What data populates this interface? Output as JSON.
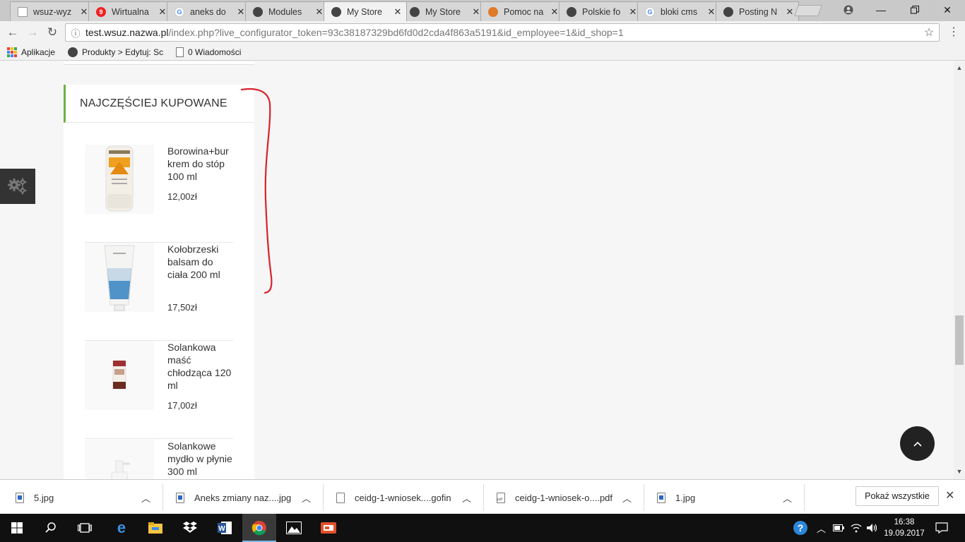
{
  "browser": {
    "tabs": [
      {
        "title": "wsuz-wyz",
        "favicon": "doc-icon",
        "active": false
      },
      {
        "title": "Wirtualna",
        "favicon": "wp-icon",
        "badge": "9",
        "active": false
      },
      {
        "title": "aneks do",
        "favicon": "google-icon",
        "active": false
      },
      {
        "title": "Modules",
        "favicon": "prestashop-icon",
        "active": false
      },
      {
        "title": "My Store",
        "favicon": "prestashop-icon",
        "active": true
      },
      {
        "title": "My Store",
        "favicon": "prestashop-icon",
        "active": false
      },
      {
        "title": "Pomoc na",
        "favicon": "prestashop-orange-icon",
        "active": false
      },
      {
        "title": "Polskie fo",
        "favicon": "prestashop-icon",
        "active": false
      },
      {
        "title": "bloki cms",
        "favicon": "google-icon",
        "active": false
      },
      {
        "title": "Posting N",
        "favicon": "prestashop-icon",
        "active": false
      }
    ],
    "address": {
      "host": "test.wsuz.nazwa.pl",
      "path": "/index.php?live_configurator_token=93c38187329bd6fd0d2cda4f863a5191&id_employee=1&id_shop=1"
    },
    "bookmarks": [
      {
        "label": "Aplikacje",
        "icon": "apps-icon"
      },
      {
        "label": "Produkty > Edytuj: Sc",
        "icon": "prestashop-icon"
      },
      {
        "label": "0 Wiadomości",
        "icon": "page-icon"
      }
    ]
  },
  "page": {
    "block_title": "NAJCZĘŚCIEJ KUPOWANE",
    "products": [
      {
        "name": "Borowina+bur krem do stóp 100 ml",
        "price": "12,00zł"
      },
      {
        "name": "Kołobrzeski balsam do ciała 200 ml",
        "price": "17,50zł"
      },
      {
        "name": "Solankowa maść chłodząca 120 ml",
        "price": "17,00zł"
      },
      {
        "name": "Solankowe mydło w płynie 300 ml",
        "price": ""
      }
    ],
    "colors": {
      "accent": "#6cb33f",
      "annotation": "#d8232a",
      "scroll_top_bg": "#222222"
    }
  },
  "downloads": {
    "items": [
      {
        "name": "5.jpg",
        "type": "img"
      },
      {
        "name": "Aneks zmiany naz....jpg",
        "type": "img"
      },
      {
        "name": "ceidg-1-wniosek....gofin",
        "type": "file"
      },
      {
        "name": "ceidg-1-wniosek-o....pdf",
        "type": "pdf"
      },
      {
        "name": "1.jpg",
        "type": "img"
      }
    ],
    "show_all": "Pokaż wszystkie"
  },
  "taskbar": {
    "time": "16:38",
    "date": "19.09.2017"
  }
}
